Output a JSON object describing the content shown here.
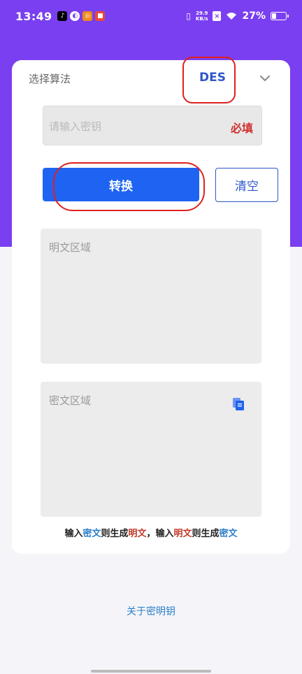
{
  "status_bar": {
    "time": "13:49",
    "net_speed_value": "29.9",
    "net_speed_unit": "KB/s",
    "battery_percent": "27%",
    "battery_level": 0.27
  },
  "colors": {
    "header_purple": "#7a3ff0",
    "primary_blue": "#1e63f2",
    "link_blue": "#2a7fc9",
    "required_red": "#d03030",
    "highlight_red": "#e02020"
  },
  "algorithm": {
    "label": "选择算法",
    "selected": "DES",
    "dropdown_icon": "chevron-down-icon"
  },
  "key": {
    "placeholder": "请输入密钥",
    "value": "",
    "required_label": "必填"
  },
  "buttons": {
    "convert": "转换",
    "clear": "清空"
  },
  "plaintext": {
    "placeholder": "明文区域",
    "value": ""
  },
  "ciphertext": {
    "placeholder": "密文区域",
    "value": "",
    "copy_icon": "copy-icon"
  },
  "hint": {
    "p1": "输入",
    "w1": "密文",
    "p2": "则生成",
    "w2": "明文",
    "p3": "，输入",
    "w3": "明文",
    "p4": "则生成",
    "w4": "密文"
  },
  "footer": {
    "about_link": "关于密明钥"
  }
}
